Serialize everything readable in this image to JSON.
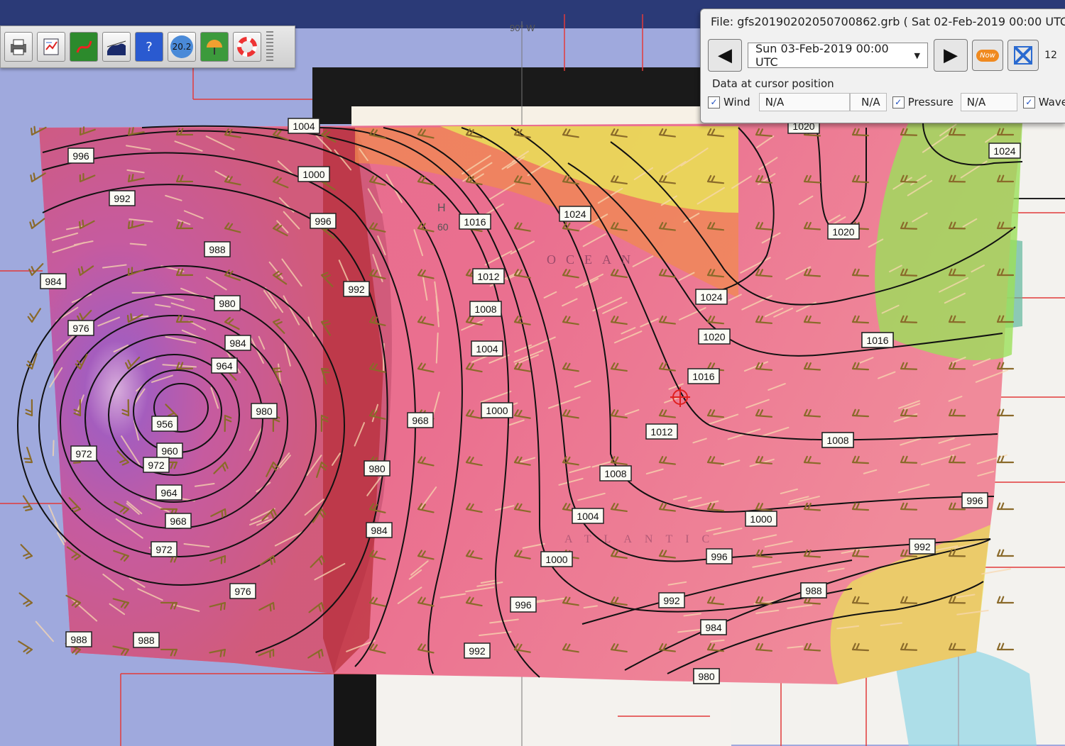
{
  "toolbar": {
    "buttons": [
      {
        "name": "print-button",
        "icon": "printer-icon"
      },
      {
        "name": "route-checklist-button",
        "icon": "checklist-icon"
      },
      {
        "name": "route-button",
        "icon": "route-icon"
      },
      {
        "name": "tide-button",
        "icon": "tide-icon"
      },
      {
        "name": "help-button",
        "icon": "help-icon",
        "label": "?"
      },
      {
        "name": "current-button",
        "icon": "current-icon",
        "label": "20.2"
      },
      {
        "name": "weather-button",
        "icon": "umbrella-icon"
      },
      {
        "name": "lifebuoy-button",
        "icon": "lifebuoy-icon"
      }
    ]
  },
  "grib": {
    "file_line": "File: gfs20190202050700862.grb ( Sat 02-Feb-2019 00:00  UTC )",
    "selected_time": "Sun 03-Feb-2019 00:00  UTC",
    "now_label": "Now",
    "cursor_title": "Data at cursor position",
    "wind_label": "Wind",
    "wind_value": "N/A",
    "wind_value2": "N/A",
    "pressure_label": "Pressure",
    "pressure_value": "N/A",
    "wave_label": "Wave",
    "corner_number": "12"
  },
  "map": {
    "longitude_label": "90° W",
    "ocean_label": "OCEAN",
    "atlantic_label": "ATLANTIC",
    "side_letter": "H",
    "side_number": "60",
    "isobar_labels": [
      "1004",
      "996",
      "1000",
      "992",
      "996",
      "988",
      "984",
      "980",
      "976",
      "972",
      "964",
      "956",
      "960",
      "972",
      "964",
      "968",
      "972",
      "976",
      "980",
      "968",
      "988",
      "984",
      "992",
      "1016",
      "1024",
      "1012",
      "1008",
      "1004",
      "1000",
      "988",
      "980",
      "984",
      "1016",
      "1024",
      "1020",
      "1016",
      "1012",
      "1008",
      "1004",
      "1000",
      "996",
      "992",
      "988",
      "984",
      "980",
      "1000",
      "996",
      "992",
      "1008",
      "1020",
      "1024",
      "1020",
      "1016",
      "1008",
      "996",
      "992",
      "988",
      "984",
      "980"
    ]
  },
  "colors": {
    "pressure_low": "#b85ca8",
    "pressure_mid": "#e9708c",
    "pressure_high": "#f3a060",
    "wind_strong": "#f6d6a8",
    "barb": "#8a6a2a",
    "isobar": "#111111",
    "grid": "#e23a3a"
  }
}
